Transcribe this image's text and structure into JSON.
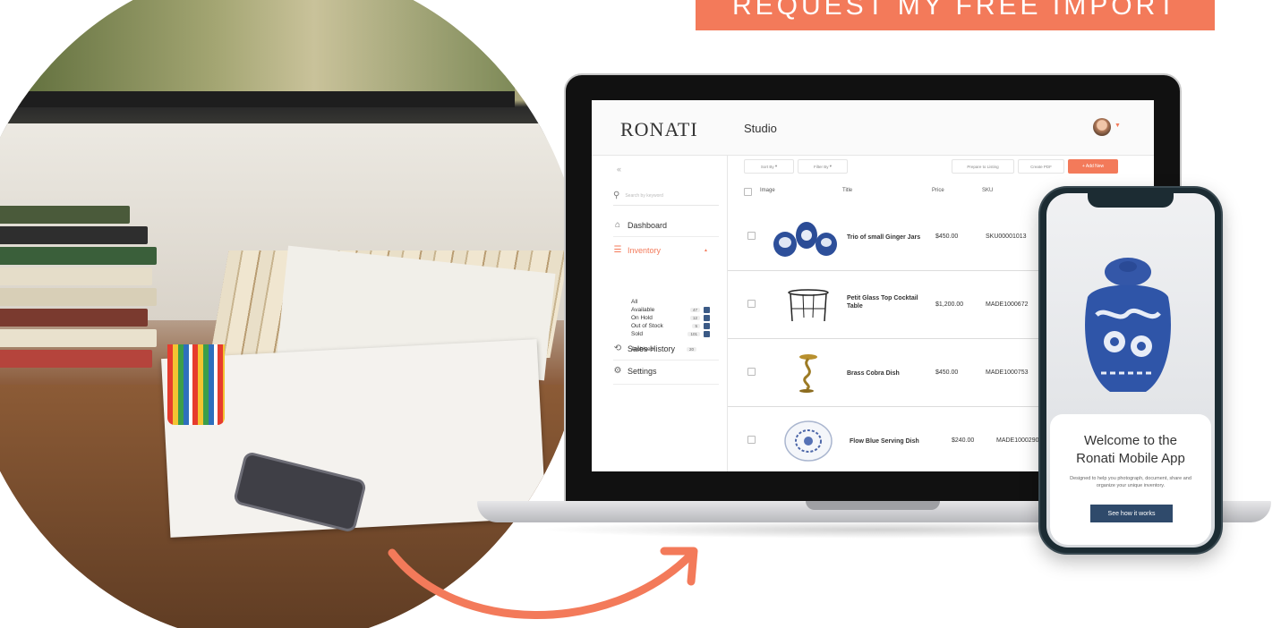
{
  "cta": {
    "label": "REQUEST MY FREE IMPORT"
  },
  "app": {
    "brand": "RONATI",
    "header_title": "Studio",
    "search_placeholder": "Search by keyword",
    "nav": {
      "dashboard": "Dashboard",
      "inventory": "Inventory",
      "sales_history": "Sales History",
      "settings": "Settings"
    },
    "inventory_filters": [
      {
        "label": "All",
        "count": "",
        "checked": false
      },
      {
        "label": "Available",
        "count": "47",
        "checked": true
      },
      {
        "label": "On Hold",
        "count": "12",
        "checked": true
      },
      {
        "label": "Out of Stock",
        "count": "5",
        "checked": true
      },
      {
        "label": "Sold",
        "count": "101",
        "checked": true
      }
    ],
    "archived": {
      "label": "Archived",
      "count": "20"
    },
    "toolbar": {
      "sort_by": "Sort By",
      "filter_by": "Filter By",
      "prepare": "Prepare to Listing",
      "create_pdf": "Create PDF",
      "add_new": "+ Add New"
    },
    "table": {
      "headers": {
        "image": "Image",
        "title": "Title",
        "price": "Price",
        "sku": "SKU"
      },
      "rows": [
        {
          "title": "Trio of small Ginger Jars",
          "price": "$450.00",
          "sku": "SKU00001013"
        },
        {
          "title": "Petit Glass Top Cocktail Table",
          "price": "$1,200.00",
          "sku": "MADE1000672"
        },
        {
          "title": "Brass Cobra Dish",
          "price": "$450.00",
          "sku": "MADE1000753"
        },
        {
          "title": "Flow Blue Serving Dish",
          "price": "$240.00",
          "sku": "MADE1000290"
        }
      ]
    }
  },
  "mobile": {
    "title_line1": "Welcome to the",
    "title_line2": "Ronati Mobile App",
    "description": "Designed to help you photograph, document, share and organize your unique inventory.",
    "button": "See how it works"
  },
  "colors": {
    "accent": "#f37a5a",
    "navy": "#2f4a6b",
    "checkbox": "#3b5a86"
  },
  "icons": [
    "search-icon",
    "home-icon",
    "list-icon",
    "history-icon",
    "gear-icon",
    "caret-up-icon",
    "arrow-icon"
  ]
}
